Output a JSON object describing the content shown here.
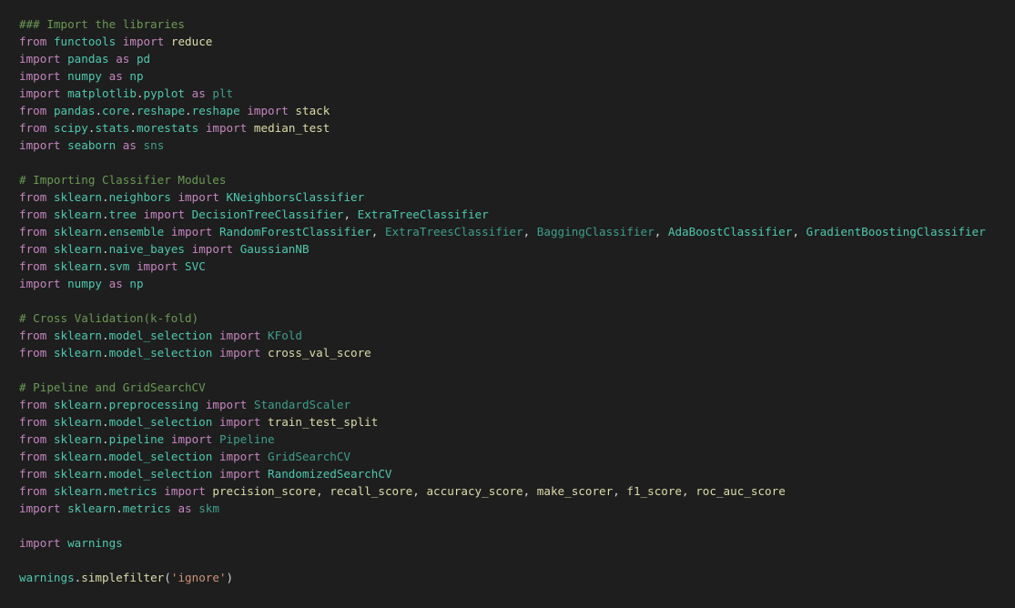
{
  "code": {
    "lines": [
      [
        {
          "t": "### Import the libraries",
          "k": "cm"
        }
      ],
      [
        {
          "t": "from",
          "k": "kw"
        },
        {
          "t": " "
        },
        {
          "t": "functools",
          "k": "mod"
        },
        {
          "t": " "
        },
        {
          "t": "import",
          "k": "kw"
        },
        {
          "t": " "
        },
        {
          "t": "reduce",
          "k": "fn"
        }
      ],
      [
        {
          "t": "import",
          "k": "kw"
        },
        {
          "t": " "
        },
        {
          "t": "pandas",
          "k": "mod"
        },
        {
          "t": " "
        },
        {
          "t": "as",
          "k": "kw"
        },
        {
          "t": " "
        },
        {
          "t": "pd",
          "k": "mod"
        }
      ],
      [
        {
          "t": "import",
          "k": "kw"
        },
        {
          "t": " "
        },
        {
          "t": "numpy",
          "k": "mod"
        },
        {
          "t": " "
        },
        {
          "t": "as",
          "k": "kw"
        },
        {
          "t": " "
        },
        {
          "t": "np",
          "k": "mod"
        }
      ],
      [
        {
          "t": "import",
          "k": "kw"
        },
        {
          "t": " "
        },
        {
          "t": "matplotlib",
          "k": "mod"
        },
        {
          "t": "."
        },
        {
          "t": "pyplot",
          "k": "mod"
        },
        {
          "t": " "
        },
        {
          "t": "as",
          "k": "kw"
        },
        {
          "t": " "
        },
        {
          "t": "plt",
          "k": "dim"
        }
      ],
      [
        {
          "t": "from",
          "k": "kw"
        },
        {
          "t": " "
        },
        {
          "t": "pandas",
          "k": "mod"
        },
        {
          "t": "."
        },
        {
          "t": "core",
          "k": "mod"
        },
        {
          "t": "."
        },
        {
          "t": "reshape",
          "k": "mod"
        },
        {
          "t": "."
        },
        {
          "t": "reshape",
          "k": "mod"
        },
        {
          "t": " "
        },
        {
          "t": "import",
          "k": "kw"
        },
        {
          "t": " "
        },
        {
          "t": "stack",
          "k": "fn"
        }
      ],
      [
        {
          "t": "from",
          "k": "kw"
        },
        {
          "t": " "
        },
        {
          "t": "scipy",
          "k": "mod"
        },
        {
          "t": "."
        },
        {
          "t": "stats",
          "k": "mod"
        },
        {
          "t": "."
        },
        {
          "t": "morestats",
          "k": "mod"
        },
        {
          "t": " "
        },
        {
          "t": "import",
          "k": "kw"
        },
        {
          "t": " "
        },
        {
          "t": "median_test",
          "k": "fn"
        }
      ],
      [
        {
          "t": "import",
          "k": "kw"
        },
        {
          "t": " "
        },
        {
          "t": "seaborn",
          "k": "mod"
        },
        {
          "t": " "
        },
        {
          "t": "as",
          "k": "kw"
        },
        {
          "t": " "
        },
        {
          "t": "sns",
          "k": "dim"
        }
      ],
      [],
      [
        {
          "t": "# Importing Classifier Modules",
          "k": "cm"
        }
      ],
      [
        {
          "t": "from",
          "k": "kw"
        },
        {
          "t": " "
        },
        {
          "t": "sklearn",
          "k": "mod"
        },
        {
          "t": "."
        },
        {
          "t": "neighbors",
          "k": "mod"
        },
        {
          "t": " "
        },
        {
          "t": "import",
          "k": "kw"
        },
        {
          "t": " "
        },
        {
          "t": "KNeighborsClassifier",
          "k": "cls"
        }
      ],
      [
        {
          "t": "from",
          "k": "kw"
        },
        {
          "t": " "
        },
        {
          "t": "sklearn",
          "k": "mod"
        },
        {
          "t": "."
        },
        {
          "t": "tree",
          "k": "mod"
        },
        {
          "t": " "
        },
        {
          "t": "import",
          "k": "kw"
        },
        {
          "t": " "
        },
        {
          "t": "DecisionTreeClassifier",
          "k": "cls"
        },
        {
          "t": ", "
        },
        {
          "t": "ExtraTreeClassifier",
          "k": "cls"
        }
      ],
      [
        {
          "t": "from",
          "k": "kw"
        },
        {
          "t": " "
        },
        {
          "t": "sklearn",
          "k": "mod"
        },
        {
          "t": "."
        },
        {
          "t": "ensemble",
          "k": "mod"
        },
        {
          "t": " "
        },
        {
          "t": "import",
          "k": "kw"
        },
        {
          "t": " "
        },
        {
          "t": "RandomForestClassifier",
          "k": "cls"
        },
        {
          "t": ", "
        },
        {
          "t": "ExtraTreesClassifier",
          "k": "dim"
        },
        {
          "t": ", "
        },
        {
          "t": "BaggingClassifier",
          "k": "dim"
        },
        {
          "t": ", "
        },
        {
          "t": "AdaBoostClassifier",
          "k": "cls"
        },
        {
          "t": ", "
        },
        {
          "t": "GradientBoostingClassifier",
          "k": "cls"
        }
      ],
      [
        {
          "t": "from",
          "k": "kw"
        },
        {
          "t": " "
        },
        {
          "t": "sklearn",
          "k": "mod"
        },
        {
          "t": "."
        },
        {
          "t": "naive_bayes",
          "k": "mod"
        },
        {
          "t": " "
        },
        {
          "t": "import",
          "k": "kw"
        },
        {
          "t": " "
        },
        {
          "t": "GaussianNB",
          "k": "cls"
        }
      ],
      [
        {
          "t": "from",
          "k": "kw"
        },
        {
          "t": " "
        },
        {
          "t": "sklearn",
          "k": "mod"
        },
        {
          "t": "."
        },
        {
          "t": "svm",
          "k": "mod"
        },
        {
          "t": " "
        },
        {
          "t": "import",
          "k": "kw"
        },
        {
          "t": " "
        },
        {
          "t": "SVC",
          "k": "cls"
        }
      ],
      [
        {
          "t": "import",
          "k": "kw"
        },
        {
          "t": " "
        },
        {
          "t": "numpy",
          "k": "mod"
        },
        {
          "t": " "
        },
        {
          "t": "as",
          "k": "kw"
        },
        {
          "t": " "
        },
        {
          "t": "np",
          "k": "mod"
        }
      ],
      [],
      [
        {
          "t": "# Cross Validation(k-fold)",
          "k": "cm"
        }
      ],
      [
        {
          "t": "from",
          "k": "kw"
        },
        {
          "t": " "
        },
        {
          "t": "sklearn",
          "k": "mod"
        },
        {
          "t": "."
        },
        {
          "t": "model_selection",
          "k": "mod"
        },
        {
          "t": " "
        },
        {
          "t": "import",
          "k": "kw"
        },
        {
          "t": " "
        },
        {
          "t": "KFold",
          "k": "dim"
        }
      ],
      [
        {
          "t": "from",
          "k": "kw"
        },
        {
          "t": " "
        },
        {
          "t": "sklearn",
          "k": "mod"
        },
        {
          "t": "."
        },
        {
          "t": "model_selection",
          "k": "mod"
        },
        {
          "t": " "
        },
        {
          "t": "import",
          "k": "kw"
        },
        {
          "t": " "
        },
        {
          "t": "cross_val_score",
          "k": "fn"
        }
      ],
      [],
      [
        {
          "t": "# Pipeline and GridSearchCV",
          "k": "cm"
        }
      ],
      [
        {
          "t": "from",
          "k": "kw"
        },
        {
          "t": " "
        },
        {
          "t": "sklearn",
          "k": "mod"
        },
        {
          "t": "."
        },
        {
          "t": "preprocessing",
          "k": "mod"
        },
        {
          "t": " "
        },
        {
          "t": "import",
          "k": "kw"
        },
        {
          "t": " "
        },
        {
          "t": "StandardScaler",
          "k": "dim"
        }
      ],
      [
        {
          "t": "from",
          "k": "kw"
        },
        {
          "t": " "
        },
        {
          "t": "sklearn",
          "k": "mod"
        },
        {
          "t": "."
        },
        {
          "t": "model_selection",
          "k": "mod"
        },
        {
          "t": " "
        },
        {
          "t": "import",
          "k": "kw"
        },
        {
          "t": " "
        },
        {
          "t": "train_test_split",
          "k": "fn"
        }
      ],
      [
        {
          "t": "from",
          "k": "kw"
        },
        {
          "t": " "
        },
        {
          "t": "sklearn",
          "k": "mod"
        },
        {
          "t": "."
        },
        {
          "t": "pipeline",
          "k": "mod"
        },
        {
          "t": " "
        },
        {
          "t": "import",
          "k": "kw"
        },
        {
          "t": " "
        },
        {
          "t": "Pipeline",
          "k": "dim"
        }
      ],
      [
        {
          "t": "from",
          "k": "kw"
        },
        {
          "t": " "
        },
        {
          "t": "sklearn",
          "k": "mod"
        },
        {
          "t": "."
        },
        {
          "t": "model_selection",
          "k": "mod"
        },
        {
          "t": " "
        },
        {
          "t": "import",
          "k": "kw"
        },
        {
          "t": " "
        },
        {
          "t": "GridSearchCV",
          "k": "dim"
        }
      ],
      [
        {
          "t": "from",
          "k": "kw"
        },
        {
          "t": " "
        },
        {
          "t": "sklearn",
          "k": "mod"
        },
        {
          "t": "."
        },
        {
          "t": "model_selection",
          "k": "mod"
        },
        {
          "t": " "
        },
        {
          "t": "import",
          "k": "kw"
        },
        {
          "t": " "
        },
        {
          "t": "RandomizedSearchCV",
          "k": "cls"
        }
      ],
      [
        {
          "t": "from",
          "k": "kw"
        },
        {
          "t": " "
        },
        {
          "t": "sklearn",
          "k": "mod"
        },
        {
          "t": "."
        },
        {
          "t": "metrics",
          "k": "mod"
        },
        {
          "t": " "
        },
        {
          "t": "import",
          "k": "kw"
        },
        {
          "t": " "
        },
        {
          "t": "precision_score",
          "k": "fn"
        },
        {
          "t": ", "
        },
        {
          "t": "recall_score",
          "k": "fn"
        },
        {
          "t": ", "
        },
        {
          "t": "accuracy_score",
          "k": "fn"
        },
        {
          "t": ", "
        },
        {
          "t": "make_scorer",
          "k": "fn"
        },
        {
          "t": ", "
        },
        {
          "t": "f1_score",
          "k": "fn"
        },
        {
          "t": ", "
        },
        {
          "t": "roc_auc_score",
          "k": "fn"
        }
      ],
      [
        {
          "t": "import",
          "k": "kw"
        },
        {
          "t": " "
        },
        {
          "t": "sklearn",
          "k": "mod"
        },
        {
          "t": "."
        },
        {
          "t": "metrics",
          "k": "mod"
        },
        {
          "t": " "
        },
        {
          "t": "as",
          "k": "kw"
        },
        {
          "t": " "
        },
        {
          "t": "skm",
          "k": "dim"
        }
      ],
      [],
      [
        {
          "t": "import",
          "k": "kw"
        },
        {
          "t": " "
        },
        {
          "t": "warnings",
          "k": "mod"
        }
      ],
      [],
      [
        {
          "t": "warnings",
          "k": "mod"
        },
        {
          "t": "."
        },
        {
          "t": "simplefilter",
          "k": "fn"
        },
        {
          "t": "("
        },
        {
          "t": "'ignore'",
          "k": "str"
        },
        {
          "t": ")"
        }
      ]
    ]
  },
  "colors": {
    "background": "#1e1e1e",
    "keyword": "#c586c0",
    "module": "#4ec9b0",
    "function": "#dcdcaa",
    "comment": "#6a9955",
    "string": "#ce9178",
    "plain": "#d4d4d4"
  }
}
